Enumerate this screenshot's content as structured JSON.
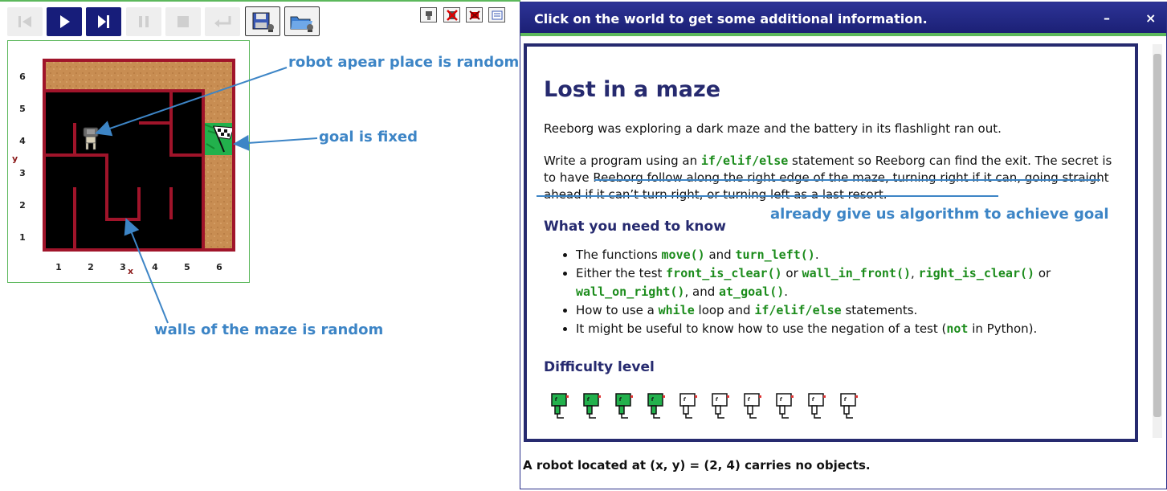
{
  "dialog": {
    "title": "Click on the world to get some additional information.",
    "minimize": "–",
    "close": "×",
    "heading": "Lost in a maze",
    "para1": "Reeborg was exploring a dark maze and the battery in its flashlight ran out.",
    "para2": {
      "a": "Write a program using an ",
      "code": "if/elif/else",
      "b": " statement so Reeborg can find the exit. The secret is to have Reeborg follow along the right edge of the maze, turning right if it can, going straight ahead if it can’t turn right, or turning left as a last resort."
    },
    "know_heading": "What you need to know",
    "know": [
      {
        "a": "The functions ",
        "c1": "move()",
        "b": " and ",
        "c2": "turn_left()",
        "c": "."
      },
      {
        "a": "Either the test ",
        "c1": "front_is_clear()",
        "b": " or ",
        "c2": "wall_in_front()",
        "c": ", ",
        "c3": "right_is_clear()",
        "d": " or ",
        "c4": "wall_on_right()",
        "e": ", and ",
        "c5": "at_goal()",
        "f": "."
      },
      {
        "a": "How to use a ",
        "c1": "while",
        "b": " loop and ",
        "c2": "if/elif/else",
        "c": " statements."
      },
      {
        "a": "It might be useful to know how to use the negation of a test (",
        "c1": "not",
        "b": " in Python)."
      }
    ],
    "difficulty_heading": "Difficulty level",
    "difficulty": 4,
    "difficulty_max": 10,
    "status": "A robot located at (x, y) = (2, 4) carries no objects."
  },
  "world": {
    "y_labels": [
      "6",
      "5",
      "4",
      "3",
      "2",
      "1"
    ],
    "x_labels": [
      "1",
      "2",
      "3",
      "4",
      "5",
      "6"
    ],
    "x_axis": "x",
    "y_axis": "y",
    "robot": {
      "x": 2,
      "y": 4
    },
    "goal": {
      "x": 6,
      "y": 4
    }
  },
  "annotations": {
    "robot": "robot apear place is random",
    "goal": "goal is fixed",
    "walls": "walls of the maze is random",
    "algorithm": "already give us algorithm to achieve goal"
  },
  "colors": {
    "accent": "#171d7a",
    "annotation": "#3d85c6",
    "code": "#1c8c1c",
    "wall": "#a0142a",
    "goal": "#22b14c"
  },
  "icons": [
    "reload-icon",
    "play-icon",
    "step-icon",
    "pause-icon",
    "stop-icon",
    "return-icon",
    "save-icon",
    "open-icon"
  ]
}
